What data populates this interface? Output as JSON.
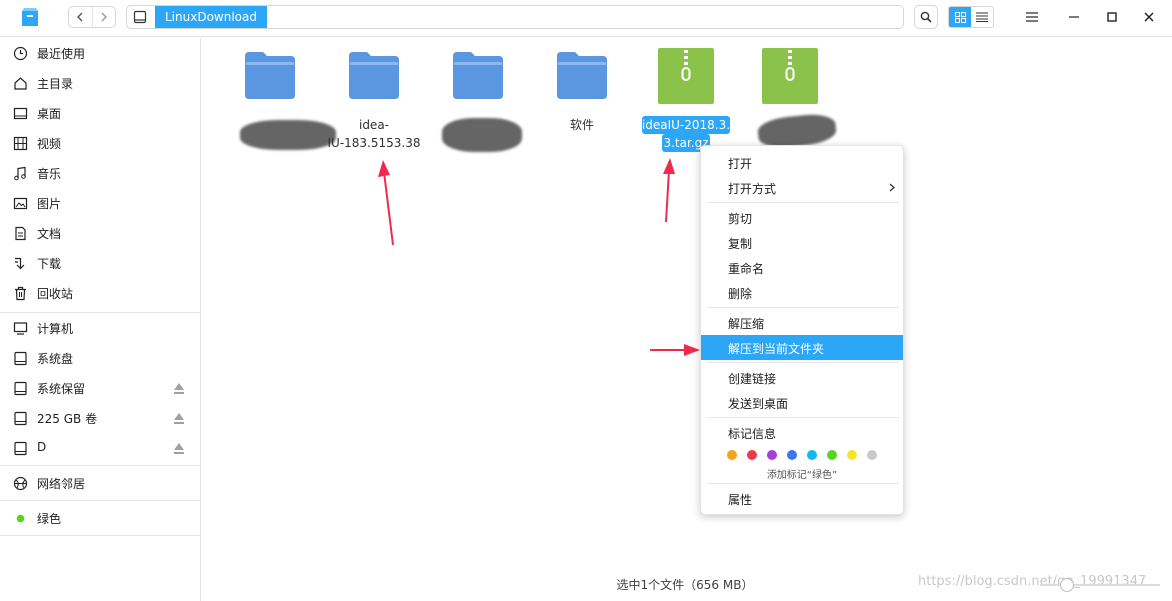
{
  "window": {
    "breadcrumb_current": "LinuxDownload",
    "nav_back": "<",
    "nav_forward": ">"
  },
  "sidebar": {
    "items": [
      {
        "label": "最近使用",
        "icon": "clock-icon"
      },
      {
        "label": "主目录",
        "icon": "home-icon"
      },
      {
        "label": "桌面",
        "icon": "desktop-icon"
      },
      {
        "label": "视频",
        "icon": "video-icon"
      },
      {
        "label": "音乐",
        "icon": "music-icon"
      },
      {
        "label": "图片",
        "icon": "picture-icon"
      },
      {
        "label": "文档",
        "icon": "document-icon"
      },
      {
        "label": "下载",
        "icon": "download-icon"
      },
      {
        "label": "回收站",
        "icon": "trash-icon"
      },
      {
        "label": "计算机",
        "icon": "computer-icon"
      },
      {
        "label": "系统盘",
        "icon": "disk-icon"
      },
      {
        "label": "系统保留",
        "icon": "disk-icon"
      },
      {
        "label": "225 GB 卷",
        "icon": "disk-icon"
      },
      {
        "label": "D",
        "icon": "disk-icon"
      },
      {
        "label": "网络邻居",
        "icon": "network-icon"
      },
      {
        "label": "绿色",
        "icon": "tag-dot-icon"
      }
    ]
  },
  "files": [
    {
      "name": "",
      "type": "folder"
    },
    {
      "name": "idea-IU-183.5153.38",
      "line1": "idea-",
      "line2": "IU-183.5153.38",
      "type": "folder"
    },
    {
      "name": "",
      "type": "folder"
    },
    {
      "name": "软件",
      "type": "folder"
    },
    {
      "name": "ideaIU-2018.3.3.tar.gz",
      "line1": "ideaIU-2018.3.",
      "line2": "3.tar.gz",
      "type": "archive",
      "selected": true
    },
    {
      "name": "",
      "type": "archive"
    }
  ],
  "context_menu": {
    "open": "打开",
    "open_with": "打开方式",
    "cut": "剪切",
    "copy": "复制",
    "rename": "重命名",
    "delete": "删除",
    "compress": "解压缩",
    "extract_here": "解压到当前文件夹",
    "create_link": "创建链接",
    "send_to_desktop": "发送到桌面",
    "tag_info": "标记信息",
    "tag_hint": "添加标记“绿色”",
    "properties": "属性",
    "tag_colors": [
      "#f7a21b",
      "#ee3a4c",
      "#a23fdd",
      "#3a78f2",
      "#13b8f0",
      "#55d625",
      "#f4e52a",
      "#c8c8c8"
    ]
  },
  "status": {
    "selection": "选中1个文件（656 MB）",
    "watermark": "https://blog.csdn.net/qq_19991347"
  },
  "colors": {
    "accent": "#2ca7f8",
    "folder": "#5b97e1",
    "archive": "#8bc34a",
    "annotation": "#ee2a4f"
  }
}
